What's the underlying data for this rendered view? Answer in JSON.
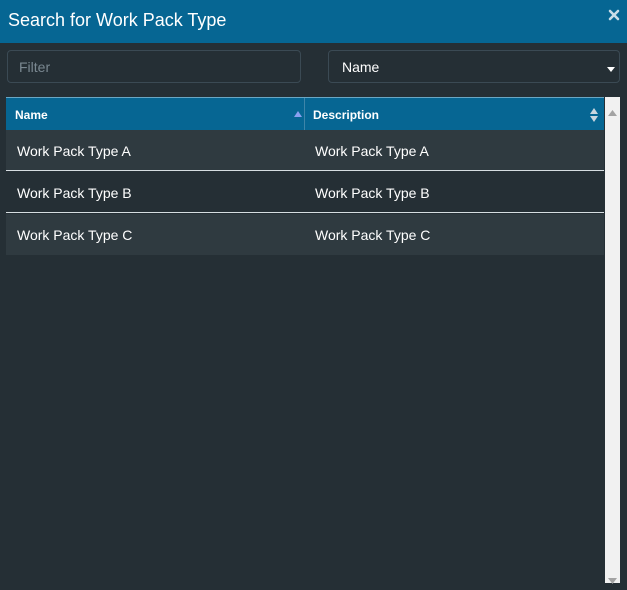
{
  "dialog": {
    "title": "Search for Work Pack Type",
    "close_icon": "close-icon"
  },
  "filter": {
    "placeholder": "Filter",
    "value": ""
  },
  "sort_select": {
    "selected": "Name",
    "caret_icon": "caret-down-icon"
  },
  "table": {
    "columns": [
      {
        "label": "Name",
        "sort": "ascending"
      },
      {
        "label": "Description",
        "sort": "none"
      }
    ],
    "rows": [
      {
        "name": "Work Pack Type A",
        "description": "Work Pack Type A"
      },
      {
        "name": "Work Pack Type B",
        "description": "Work Pack Type B"
      },
      {
        "name": "Work Pack Type C",
        "description": "Work Pack Type C"
      }
    ]
  },
  "colors": {
    "header_blue": "#066693",
    "background": "#252f35",
    "row_alt": "#2f3a40"
  }
}
